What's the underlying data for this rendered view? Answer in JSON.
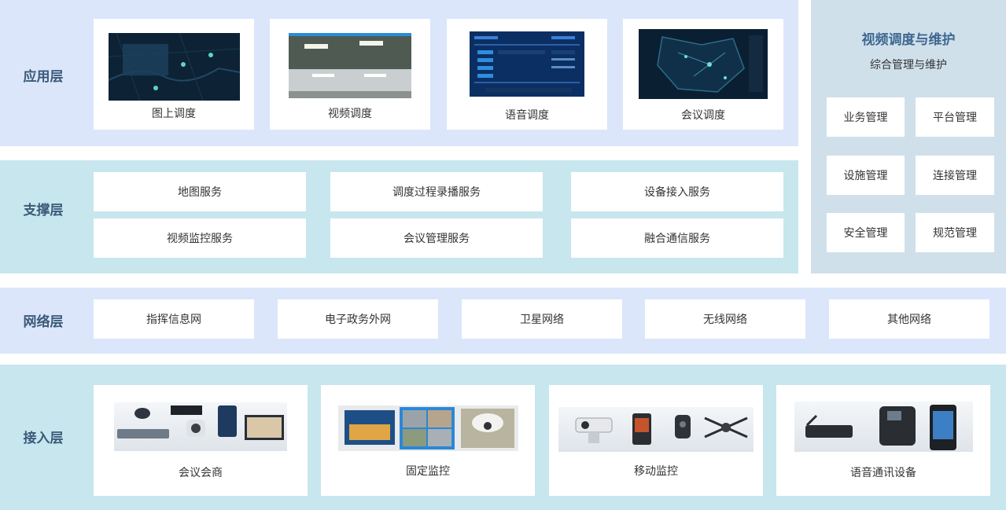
{
  "layers": {
    "application": "应用层",
    "support": "支撑层",
    "network": "网络层",
    "access": "接入层"
  },
  "application_cards": [
    {
      "label": "图上调度",
      "icon": "map-dispatch-screenshot"
    },
    {
      "label": "视频调度",
      "icon": "video-dispatch-screenshot"
    },
    {
      "label": "语音调度",
      "icon": "voice-dispatch-screenshot"
    },
    {
      "label": "会议调度",
      "icon": "conference-dispatch-screenshot"
    }
  ],
  "support_services": [
    "地图服务",
    "调度过程录播服务",
    "设备接入服务",
    "视频监控服务",
    "会议管理服务",
    "融合通信服务"
  ],
  "side_panel": {
    "title": "视频调度与维护",
    "subtitle": "综合管理与维护",
    "items": [
      "业务管理",
      "平台管理",
      "设施管理",
      "连接管理",
      "安全管理",
      "规范管理"
    ]
  },
  "network_items": [
    "指挥信息网",
    "电子政务外网",
    "卫星网络",
    "无线网络",
    "其他网络"
  ],
  "access_cards": [
    {
      "label": "会议会商",
      "icon": "conference-devices-photo"
    },
    {
      "label": "固定监控",
      "icon": "fixed-camera-photo"
    },
    {
      "label": "移动监控",
      "icon": "mobile-surveillance-photo"
    },
    {
      "label": "语音通讯设备",
      "icon": "voice-devices-photo"
    }
  ],
  "colors": {
    "blue_band": "#dbe6fb",
    "teal_band": "#c8e6ee",
    "side_panel": "#cfe0ea",
    "label_text": "#3b5a78",
    "side_title": "#3f6791"
  }
}
